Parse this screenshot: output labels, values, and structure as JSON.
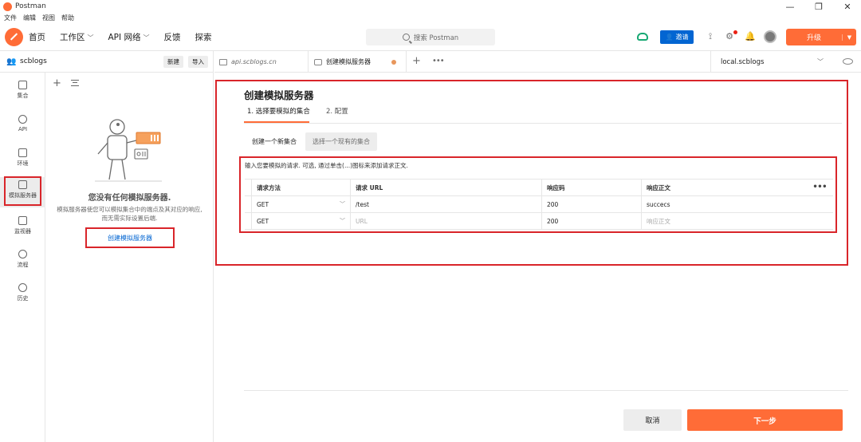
{
  "window": {
    "title": "Postman",
    "controls": [
      "—",
      "❐",
      "✕"
    ]
  },
  "menubar": [
    "文件",
    "编辑",
    "视图",
    "帮助"
  ],
  "header": {
    "nav": [
      "首页",
      "工作区",
      "API 网络",
      "反馈",
      "探索"
    ],
    "search_placeholder": "搜索 Postman",
    "invite_label": "邀请",
    "upgrade_label": "升级"
  },
  "workspace": {
    "name": "scblogs",
    "new_label": "新建",
    "import_label": "导入"
  },
  "tabs": [
    {
      "label": "api.scblogs.cn",
      "active": false
    },
    {
      "label": "创建模拟服务器",
      "active": true
    }
  ],
  "environment": {
    "selected": "local.scblogs"
  },
  "rail": [
    {
      "label": "集合",
      "icon": "collections-icon"
    },
    {
      "label": "API",
      "icon": "api-icon"
    },
    {
      "label": "环境",
      "icon": "environment-icon"
    },
    {
      "label": "模拟服务器",
      "icon": "mock-server-icon",
      "selected": true
    },
    {
      "label": "监视器",
      "icon": "monitor-icon"
    },
    {
      "label": "流程",
      "icon": "flows-icon"
    },
    {
      "label": "历史",
      "icon": "history-icon"
    }
  ],
  "sidebar": {
    "empty_title": "您没有任何模拟服务器.",
    "empty_desc": "模拟服务器使您可以模拟集合中的端点及其对应的响应, 而无需实际设置后端.",
    "create_link": "创建模拟服务器"
  },
  "main": {
    "title": "创建模拟服务器",
    "steps": [
      "1. 选择要模拟的集合",
      "2. 配置"
    ],
    "segments": [
      "创建一个新集合",
      "选择一个现有的集合"
    ],
    "table_hint": "输入您要模拟的请求. 可选, 通过单击(...)图标来添加请求正文.",
    "columns": [
      "请求方法",
      "请求 URL",
      "响应码",
      "响应正文"
    ],
    "rows": [
      {
        "method": "GET",
        "url": "/test",
        "url_placeholder": false,
        "code": "200",
        "body": "succecs",
        "body_placeholder": false
      },
      {
        "method": "GET",
        "url": "URL",
        "url_placeholder": true,
        "code": "200",
        "body": "响应正文",
        "body_placeholder": true
      }
    ],
    "cancel_label": "取消",
    "next_label": "下一步"
  },
  "colors": {
    "accent": "#ff6c37",
    "link": "#0265d2",
    "highlight": "#d9252a"
  }
}
